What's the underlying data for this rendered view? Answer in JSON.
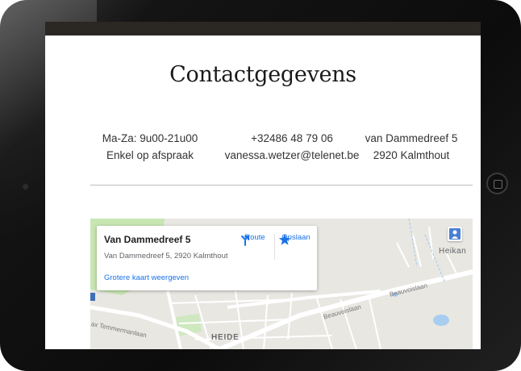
{
  "page": {
    "title": "Contactgegevens"
  },
  "contact": {
    "hours_line1": "Ma-Za: 9u00-21u00",
    "hours_line2": "Enkel op afspraak",
    "phone": "+32486 48 79 06",
    "email": "vanessa.wetzer@telenet.be",
    "street": "van Dammedreef 5",
    "city": "2920 Kalmthout"
  },
  "map": {
    "place_name": "Van Dammedreef 5",
    "place_address": "Van Dammedreef 5, 2920 Kalmthout",
    "route_label": "Route",
    "save_label": "Opslaan",
    "larger_map_link": "Grotere kaart weergeven",
    "labels": {
      "heikant": "Heikan",
      "heide": "HEIDE",
      "beauvoislaan_1": "Beauvoislaan",
      "beauvoislaan_2": "Beauvoislaan",
      "temmerman": "ax Temmermanlaan"
    },
    "colors": {
      "land": "#e9e7e2",
      "road": "#ffffff",
      "park": "#c8e6b4",
      "water": "#a8cdf0",
      "link": "#1a73e8"
    },
    "icons": {
      "route": "route-arrow-icon",
      "save": "star-icon",
      "pegman": "pegman-icon"
    }
  },
  "device": {
    "frame": "tablet-black"
  }
}
